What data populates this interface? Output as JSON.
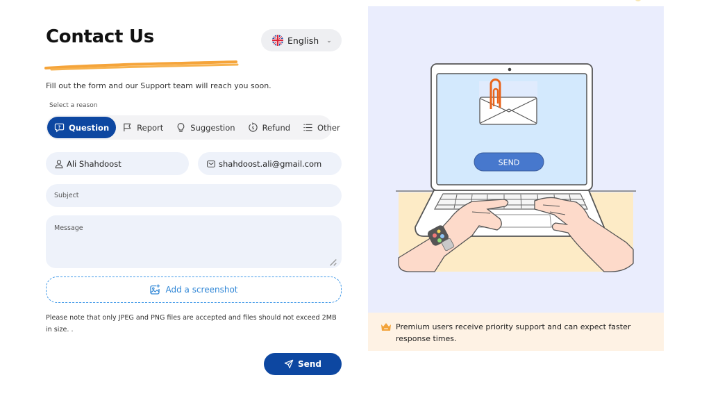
{
  "header": {
    "title": "Contact Us",
    "subtitle": "Fill out the form and our Support team will reach you soon.",
    "language": {
      "label": "English",
      "icon": "uk-flag-icon"
    }
  },
  "reasons": {
    "label": "Select a reason",
    "selected": "Question",
    "items": [
      {
        "label": "Question",
        "icon": "question-bubble-icon",
        "active": true
      },
      {
        "label": "Report",
        "icon": "flag-icon",
        "active": false
      },
      {
        "label": "Suggestion",
        "icon": "lightbulb-icon",
        "active": false
      },
      {
        "label": "Refund",
        "icon": "refund-dollar-icon",
        "active": false
      },
      {
        "label": "Other",
        "icon": "list-icon",
        "active": false
      }
    ]
  },
  "form": {
    "name": {
      "value": "Ali Shahdoost",
      "icon": "user-icon"
    },
    "email": {
      "value": "shahdoost.ali@gmail.com",
      "icon": "mail-icon"
    },
    "subject": {
      "placeholder": "Subject",
      "value": ""
    },
    "message": {
      "placeholder": "Message",
      "value": ""
    },
    "screenshot_label": "Add a screenshot",
    "note": "Please note that only JPEG and PNG files are accepted and files should not exceed 2MB in size. .",
    "send_label": "Send"
  },
  "illustration": {
    "screen_button_label": "SEND"
  },
  "premium": {
    "text": "Premium users receive priority support and can expect faster response times.",
    "icon": "crown-icon"
  },
  "colors": {
    "primary": "#0d47a1",
    "accent_dashed": "#3d97e8",
    "highlight": "#f5a43a",
    "field_bg": "#eef2fa",
    "panel_bg": "#eaedfd",
    "premium_bg": "#fef2e4"
  }
}
